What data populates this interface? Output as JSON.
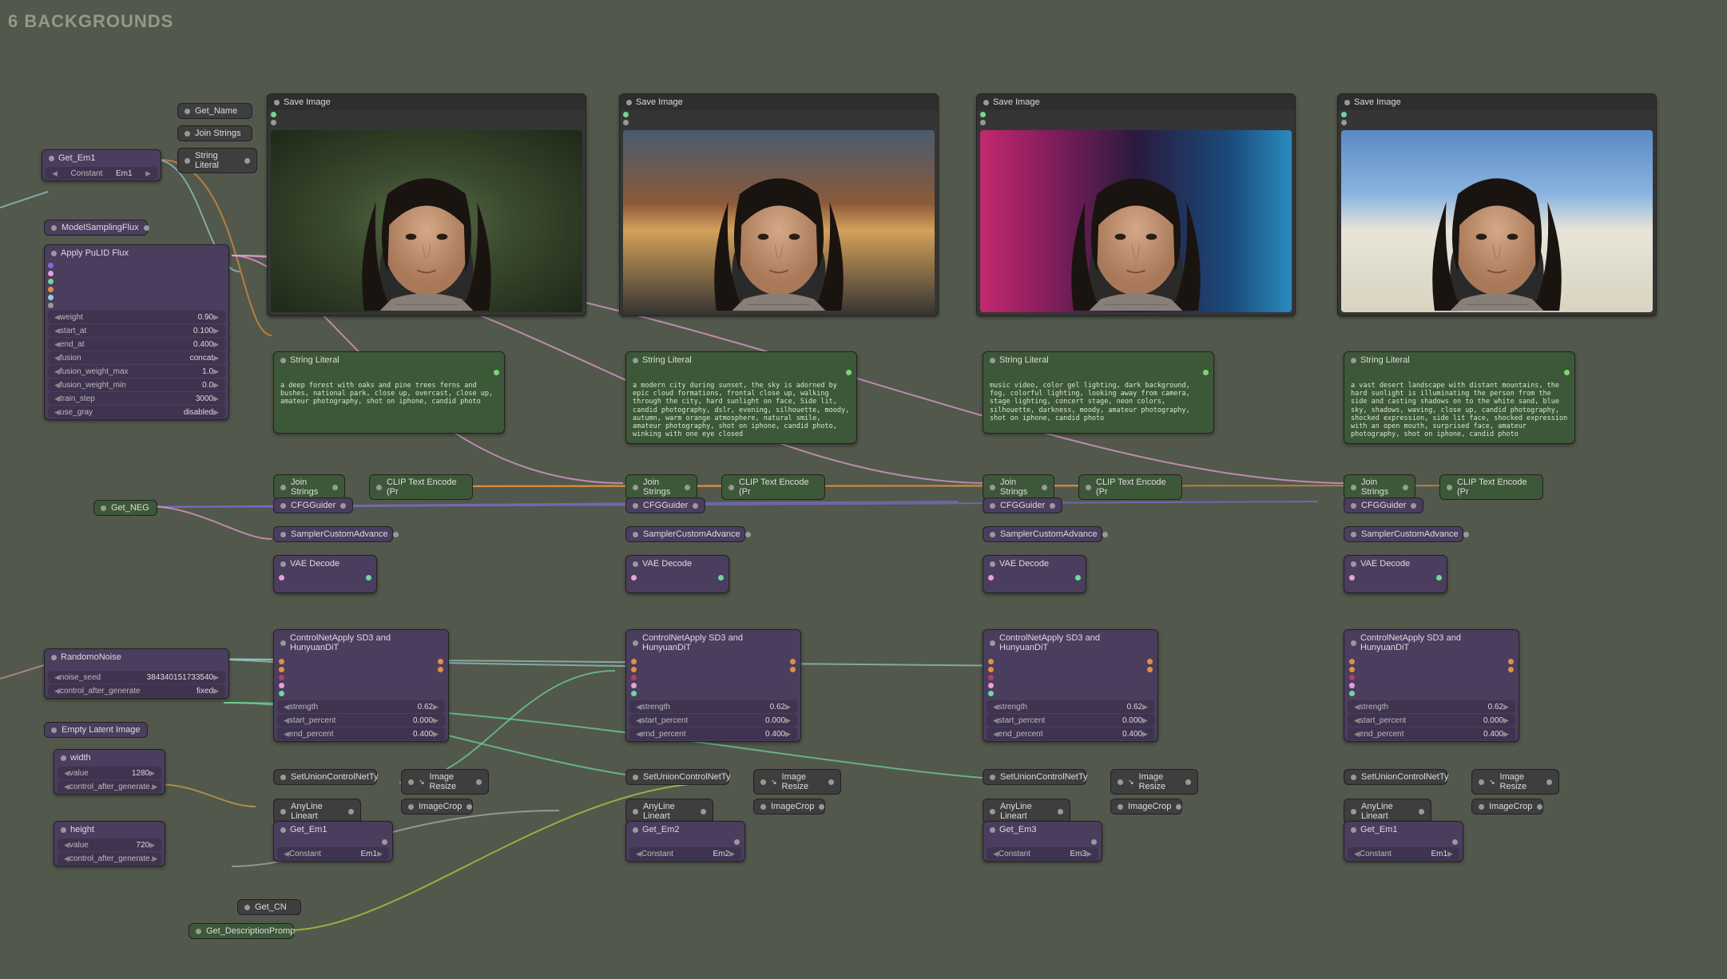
{
  "section_title": "6 BACKGROUNDS",
  "misc_nodes": {
    "get_name": "Get_Name",
    "join_strings": "Join Strings",
    "string_literal": "String Literal",
    "get_em1": "Get_Em1",
    "constant": "Constant",
    "em1": "Em1",
    "model_sampling_flux": "ModelSamplingFlux",
    "get_neg": "Get_NEG",
    "get_cn": "Get_CN",
    "get_description_promp": "Get_DescriptionPromp"
  },
  "apply_pulid": {
    "title": "Apply PuLID Flux",
    "params": [
      {
        "label": "weight",
        "value": "0.90"
      },
      {
        "label": "start_at",
        "value": "0.100"
      },
      {
        "label": "end_at",
        "value": "0.400"
      },
      {
        "label": "fusion",
        "value": "concat"
      },
      {
        "label": "fusion_weight_max",
        "value": "1.0"
      },
      {
        "label": "fusion_weight_min",
        "value": "0.0"
      },
      {
        "label": "train_step",
        "value": "3000"
      },
      {
        "label": "use_gray",
        "value": "disabled"
      }
    ]
  },
  "random_noise": {
    "title": "RandomoNoise",
    "params": [
      {
        "label": "noise_seed",
        "value": "384340151733540"
      },
      {
        "label": "control_after_generate",
        "value": "fixed"
      }
    ]
  },
  "empty_latent": {
    "title": "Empty Latent Image"
  },
  "width_node": {
    "title": "width",
    "params": [
      {
        "label": "value",
        "value": "1280"
      },
      {
        "label": "control_after_generate.",
        "value": ""
      }
    ]
  },
  "height_node": {
    "title": "height",
    "params": [
      {
        "label": "value",
        "value": "720"
      },
      {
        "label": "control_after_generate.",
        "value": ""
      }
    ]
  },
  "columns": [
    {
      "save_image": "Save Image",
      "bg_gradient": "radial-gradient(ellipse at 50% 50%, #5a6a4a 0%, #3a4a2e 40%, #1e2818 100%)",
      "string_literal_title": "String Literal",
      "prompt_text": "a deep forest with oaks and pine trees ferns and bushes, national park, close up, overcast, close up, amateur photography, shot on iphone, candid photo",
      "join_strings": "Join Strings",
      "clip_text_encode": "CLIP Text Encode (Pr",
      "cfg_guider": "CFGGuider",
      "sampler_custom": "SamplerCustomAdvance",
      "vae_decode": "VAE Decode",
      "controlnet_apply": "ControlNetApply SD3 and HunyuanDiT",
      "cn_params": [
        {
          "label": "strength",
          "value": "0.62"
        },
        {
          "label": "start_percent",
          "value": "0.000"
        },
        {
          "label": "end_percent",
          "value": "0.400"
        }
      ],
      "set_union": "SetUnionControlNetTy",
      "image_resize": "Image Resize",
      "anyline_lineart": "AnyLine Lineart",
      "image_crop": "ImageCrop",
      "get_em": "Get_Em1",
      "constant": "Constant",
      "em_val": "Em1"
    },
    {
      "save_image": "Save Image",
      "bg_gradient": "linear-gradient(180deg, #4a5b6e 0%, #8a5a3a 40%, #d4a05a 55%, #3a3832 100%)",
      "string_literal_title": "String Literal",
      "prompt_text": "a modern city during sunset, the sky is adorned by epic cloud formations, frontal close up, walking through the city, hard sunlight on face, Side lit, candid photography, dslr, evening, silhouette, moody, autumn, warm orange atmosphere, natural smile, amateur photography, shot on iphone, candid photo, winking with one eye closed",
      "join_strings": "Join Strings",
      "clip_text_encode": "CLIP Text Encode (Pr",
      "cfg_guider": "CFGGuider",
      "sampler_custom": "SamplerCustomAdvance",
      "vae_decode": "VAE Decode",
      "controlnet_apply": "ControlNetApply SD3 and HunyuanDiT",
      "cn_params": [
        {
          "label": "strength",
          "value": "0.62"
        },
        {
          "label": "start_percent",
          "value": "0.000"
        },
        {
          "label": "end_percent",
          "value": "0.400"
        }
      ],
      "set_union": "SetUnionControlNetTy",
      "image_resize": "Image Resize",
      "anyline_lineart": "AnyLine Lineart",
      "image_crop": "ImageCrop",
      "get_em": "Get_Em2",
      "constant": "Constant",
      "em_val": "Em2"
    },
    {
      "save_image": "Save Image",
      "bg_gradient": "linear-gradient(90deg, #c4286e 0%, #8a1e5e 20%, #2a1a3e 50%, #1a4a7a 80%, #2a8abe 100%)",
      "string_literal_title": "String Literal",
      "prompt_text": "music video, color gel lighting, dark background, fog, colorful lighting, looking away from camera, stage lighting, concert stage, neon colors, silhouette, darkness, moody, amateur photography, shot on iphone, candid photo",
      "join_strings": "Join Strings",
      "clip_text_encode": "CLIP Text Encode (Pr",
      "cfg_guider": "CFGGuider",
      "sampler_custom": "SamplerCustomAdvance",
      "vae_decode": "VAE Decode",
      "controlnet_apply": "ControlNetApply SD3 and HunyuanDiT",
      "cn_params": [
        {
          "label": "strength",
          "value": "0.62"
        },
        {
          "label": "start_percent",
          "value": "0.000"
        },
        {
          "label": "end_percent",
          "value": "0.400"
        }
      ],
      "set_union": "SetUnionControlNetTy",
      "image_resize": "Image Resize",
      "anyline_lineart": "AnyLine Lineart",
      "image_crop": "ImageCrop",
      "get_em": "Get_Em3",
      "constant": "Constant",
      "em_val": "Em3"
    },
    {
      "save_image": "Save Image",
      "bg_gradient": "linear-gradient(180deg, #5a8ac4 0%, #8ab4e0 35%, #e8e4d8 55%, #d8d4c0 100%)",
      "string_literal_title": "String Literal",
      "prompt_text": "a vast desert landscape with distant mountains, the hard sunlight is illuminating the person from the side and casting shadows on to the white sand, blue sky, shadows, waving, close up, candid photography, shocked expression, side lit face, shocked expression with an open mouth, surprised face, amateur photography, shot on iphone, candid photo",
      "join_strings": "Join Strings",
      "clip_text_encode": "CLIP Text Encode (Pr",
      "cfg_guider": "CFGGuider",
      "sampler_custom": "SamplerCustomAdvance",
      "vae_decode": "VAE Decode",
      "controlnet_apply": "ControlNetApply SD3 and HunyuanDiT",
      "cn_params": [
        {
          "label": "strength",
          "value": "0.62"
        },
        {
          "label": "start_percent",
          "value": "0.000"
        },
        {
          "label": "end_percent",
          "value": "0.400"
        }
      ],
      "set_union": "SetUnionControlNetTy",
      "image_resize": "Image Resize",
      "anyline_lineart": "AnyLine Lineart",
      "image_crop": "ImageCrop",
      "get_em": "Get_Em1",
      "constant": "Constant",
      "em_val": "Em1"
    }
  ]
}
